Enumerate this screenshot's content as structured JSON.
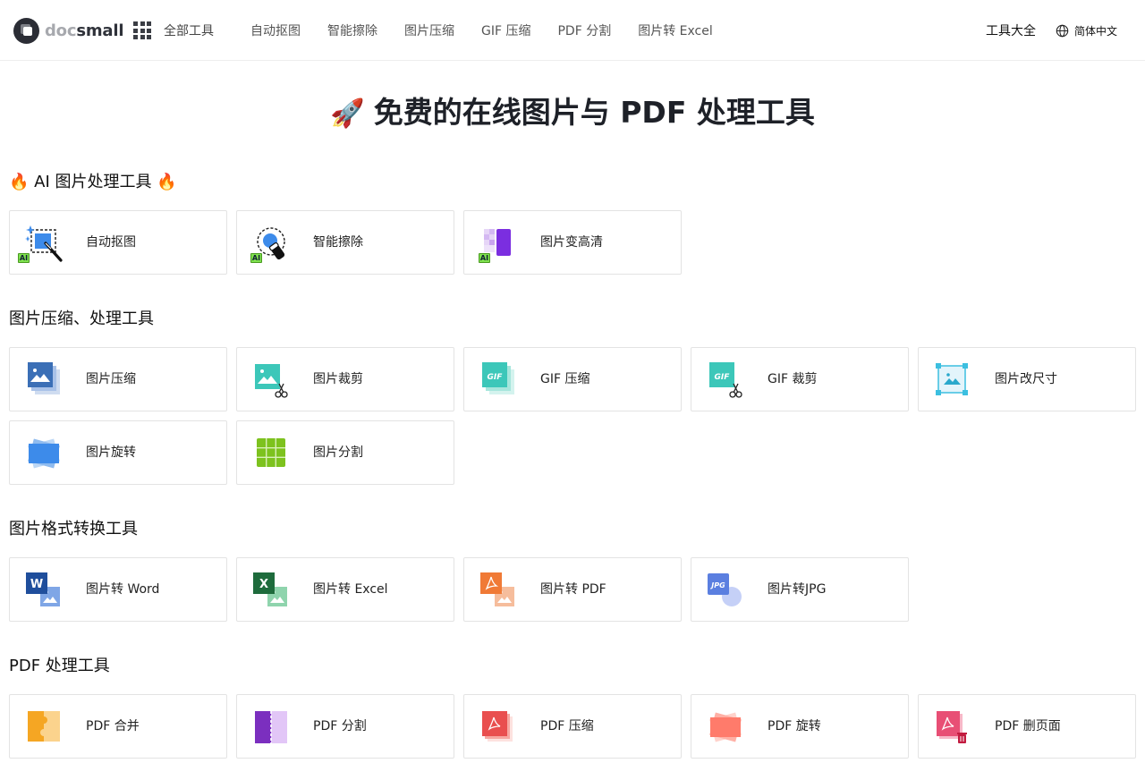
{
  "header": {
    "logo_doc": "doc",
    "logo_small": "small",
    "all_tools_label": "全部工具",
    "nav": [
      "自动抠图",
      "智能擦除",
      "图片压缩",
      "GIF 压缩",
      "PDF 分割",
      "图片转 Excel"
    ],
    "tools_directory": "工具大全",
    "language": "简体中文"
  },
  "hero": {
    "emoji": "🚀",
    "title": "免费的在线图片与 PDF 处理工具"
  },
  "sections": [
    {
      "title": "AI 图片处理工具",
      "fire": "🔥",
      "tools": [
        {
          "label": "自动抠图",
          "icon": "ai-cutout-icon"
        },
        {
          "label": "智能擦除",
          "icon": "ai-erase-icon"
        },
        {
          "label": "图片变高清",
          "icon": "ai-upscale-icon"
        }
      ]
    },
    {
      "title": "图片压缩、处理工具",
      "tools": [
        {
          "label": "图片压缩",
          "icon": "image-compress-icon"
        },
        {
          "label": "图片裁剪",
          "icon": "image-crop-icon"
        },
        {
          "label": "GIF 压缩",
          "icon": "gif-compress-icon"
        },
        {
          "label": "GIF 裁剪",
          "icon": "gif-crop-icon"
        },
        {
          "label": "图片改尺寸",
          "icon": "image-resize-icon"
        },
        {
          "label": "图片旋转",
          "icon": "image-rotate-icon"
        },
        {
          "label": "图片分割",
          "icon": "image-split-icon"
        }
      ]
    },
    {
      "title": "图片格式转换工具",
      "tools": [
        {
          "label": "图片转 Word",
          "icon": "image-to-word-icon"
        },
        {
          "label": "图片转 Excel",
          "icon": "image-to-excel-icon"
        },
        {
          "label": "图片转 PDF",
          "icon": "image-to-pdf-icon"
        },
        {
          "label": "图片转JPG",
          "icon": "image-to-jpg-icon"
        }
      ]
    },
    {
      "title": "PDF 处理工具",
      "tools": [
        {
          "label": "PDF 合并",
          "icon": "pdf-merge-icon"
        },
        {
          "label": "PDF 分割",
          "icon": "pdf-split-icon"
        },
        {
          "label": "PDF 压缩",
          "icon": "pdf-compress-icon"
        },
        {
          "label": "PDF 旋转",
          "icon": "pdf-rotate-icon"
        },
        {
          "label": "PDF 删页面",
          "icon": "pdf-delete-page-icon"
        }
      ]
    }
  ],
  "icon_text": {
    "ai": "AI",
    "gif": "GIF",
    "word": "W",
    "excel": "X",
    "jpg": "JPG"
  },
  "colors": {
    "ai_badge": "#7ee04e",
    "image_blue": "#3b6fb6",
    "teal": "#3cc7b9",
    "word_blue": "#1f4e9c",
    "excel_green": "#1e6b3c",
    "pdf_orange": "#f07a36",
    "jpg_blue": "#5b7fe0",
    "pdf_merge_orange": "#f5a623",
    "pdf_split_purple": "#7b2fbf",
    "pdf_red": "#e94f4f",
    "pdf_rotate_coral": "#ff7b6b",
    "pdf_delete_pink": "#e84f75"
  }
}
